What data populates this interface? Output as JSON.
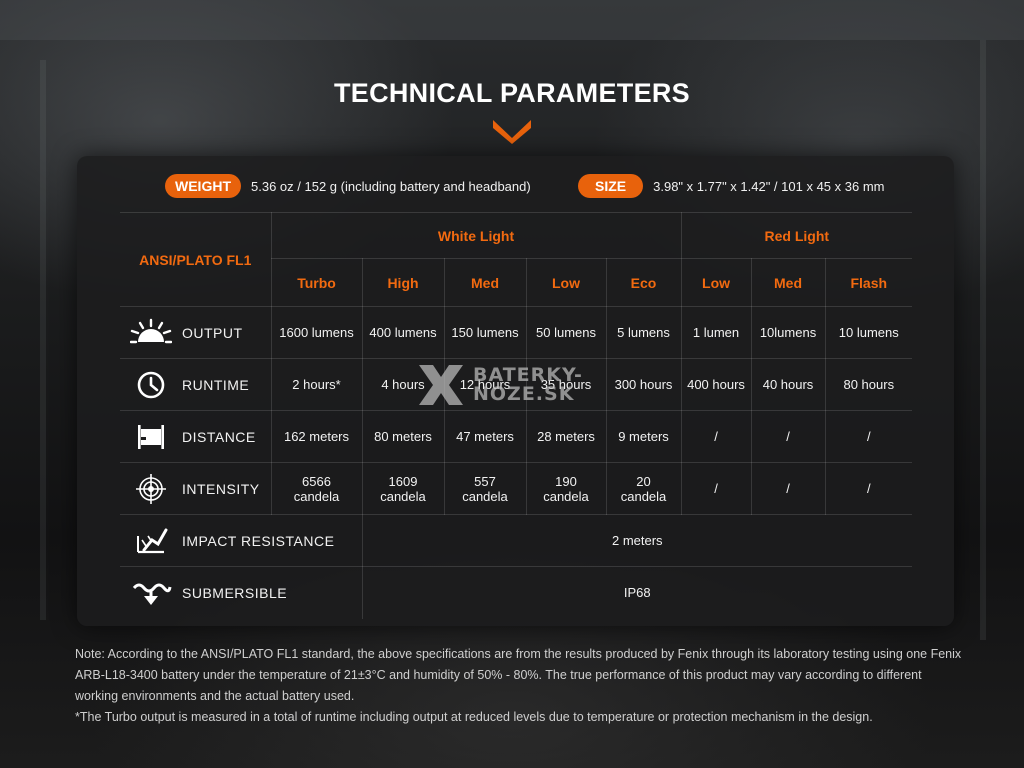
{
  "title": "TECHNICAL PARAMETERS",
  "weight": {
    "label": "WEIGHT",
    "value": "5.36 oz / 152 g (including battery and headband)"
  },
  "size": {
    "label": "SIZE",
    "value": "3.98\" x 1.77\" x 1.42\" / 101 x 45 x 36 mm"
  },
  "table": {
    "corner": "ANSI/PLATO FL1",
    "groups": {
      "white": "White Light",
      "red": "Red Light"
    },
    "modes": [
      "Turbo",
      "High",
      "Med",
      "Low",
      "Eco",
      "Low",
      "Med",
      "Flash"
    ],
    "rows": [
      {
        "icon": "output-icon",
        "label": "OUTPUT",
        "values": [
          "1600 lumens",
          "400 lumens",
          "150 lumens",
          "50 lumens",
          "5 lumens",
          "1 lumen",
          "10lumens",
          "10 lumens"
        ]
      },
      {
        "icon": "clock-icon",
        "label": "RUNTIME",
        "values": [
          "2 hours*",
          "4 hours",
          "12 hours",
          "35 hours",
          "300 hours",
          "400 hours",
          "40 hours",
          "80 hours"
        ]
      },
      {
        "icon": "distance-icon",
        "label": "DISTANCE",
        "values": [
          "162 meters",
          "80 meters",
          "47 meters",
          "28 meters",
          "9 meters",
          "/",
          "/",
          "/"
        ]
      },
      {
        "icon": "intensity-icon",
        "label": "INTENSITY",
        "values": [
          [
            "6566",
            "candela"
          ],
          [
            "1609",
            "candela"
          ],
          [
            "557",
            "candela"
          ],
          [
            "190",
            "candela"
          ],
          [
            "20",
            "candela"
          ],
          "/",
          "/",
          "/"
        ]
      }
    ],
    "impact": {
      "icon": "impact-icon",
      "label": "IMPACT RESISTANCE",
      "value": "2 meters"
    },
    "submersible": {
      "icon": "submersible-icon",
      "label": "SUBMERSIBLE",
      "value": "IP68"
    }
  },
  "watermark": {
    "line1": "BATERKY-",
    "line2": "NOZE.SK"
  },
  "note": {
    "line1": "Note: According to the ANSI/PLATO FL1 standard, the above specifications are from the results produced by Fenix through its laboratory testing using one Fenix ARB-L18-3400 battery under the temperature of 21±3°C and humidity of 50% - 80%. The true performance of this product may vary according to different working environments and the actual battery used.",
    "line2": "*The Turbo output is measured in a total of runtime including output at reduced levels due to temperature or protection mechanism in the design."
  },
  "colors": {
    "accent": "#e8620c",
    "background": "#1a1b1c"
  }
}
